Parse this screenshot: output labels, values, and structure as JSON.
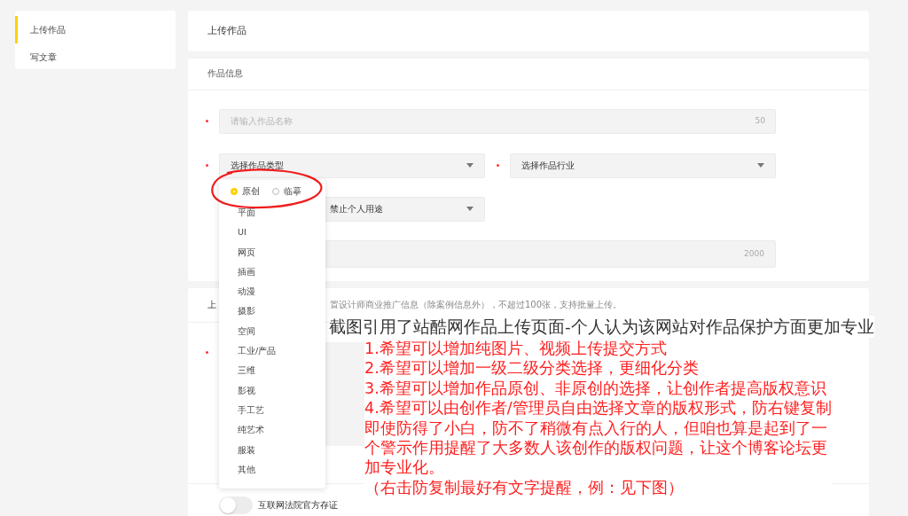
{
  "sidebar": {
    "items": [
      {
        "label": "上传作品",
        "selected": true
      },
      {
        "label": "写文章",
        "selected": false
      }
    ]
  },
  "header": {
    "title": "上传作品"
  },
  "info_section": {
    "title": "作品信息",
    "name_field": {
      "placeholder": "请输入作品名称",
      "counter": "50"
    },
    "type_select": {
      "value": "选择作品类型"
    },
    "industry_select": {
      "value": "选择作品行业"
    },
    "license_select": {
      "value": "禁止个人用途"
    },
    "description_field": {
      "counter": "2000"
    }
  },
  "type_dropdown": {
    "radios": [
      {
        "label": "原创",
        "selected": true
      },
      {
        "label": "临摹",
        "selected": false
      }
    ],
    "items": [
      "平面",
      "UI",
      "网页",
      "插画",
      "动漫",
      "摄影",
      "空间",
      "工业/产品",
      "三维",
      "影视",
      "手工艺",
      "纯艺术",
      "服装",
      "其他"
    ]
  },
  "upload_section": {
    "title": "上",
    "hint": "置设计师商业推广信息（除案例信息外），不超过100张，支持批量上传。"
  },
  "evidence_toggle": {
    "label": "互联网法院官方存证",
    "on": false
  },
  "annotation": {
    "heading": "截图引用了站酷网作品上传页面-个人认为该网站对作品保护方面更加专业",
    "lines": [
      "1.希望可以增加纯图片、视频上传提交方式",
      "2.希望可以增加一级二级分类选择，更细化分类",
      "3.希望可以增加作品原创、非原创的选择，让创作者提高版权意识",
      "4.希望可以由创作者/管理员自由选择文章的版权形式，防右键复制",
      "即使防得了小白，防不了稍微有点入行的人，但咱也算是起到了一",
      "个警示作用提醒了大多数人该创作的版权问题，让这个博客论坛更",
      "加专业化。",
      "（右击防复制最好有文字提醒，例：见下图）"
    ]
  }
}
